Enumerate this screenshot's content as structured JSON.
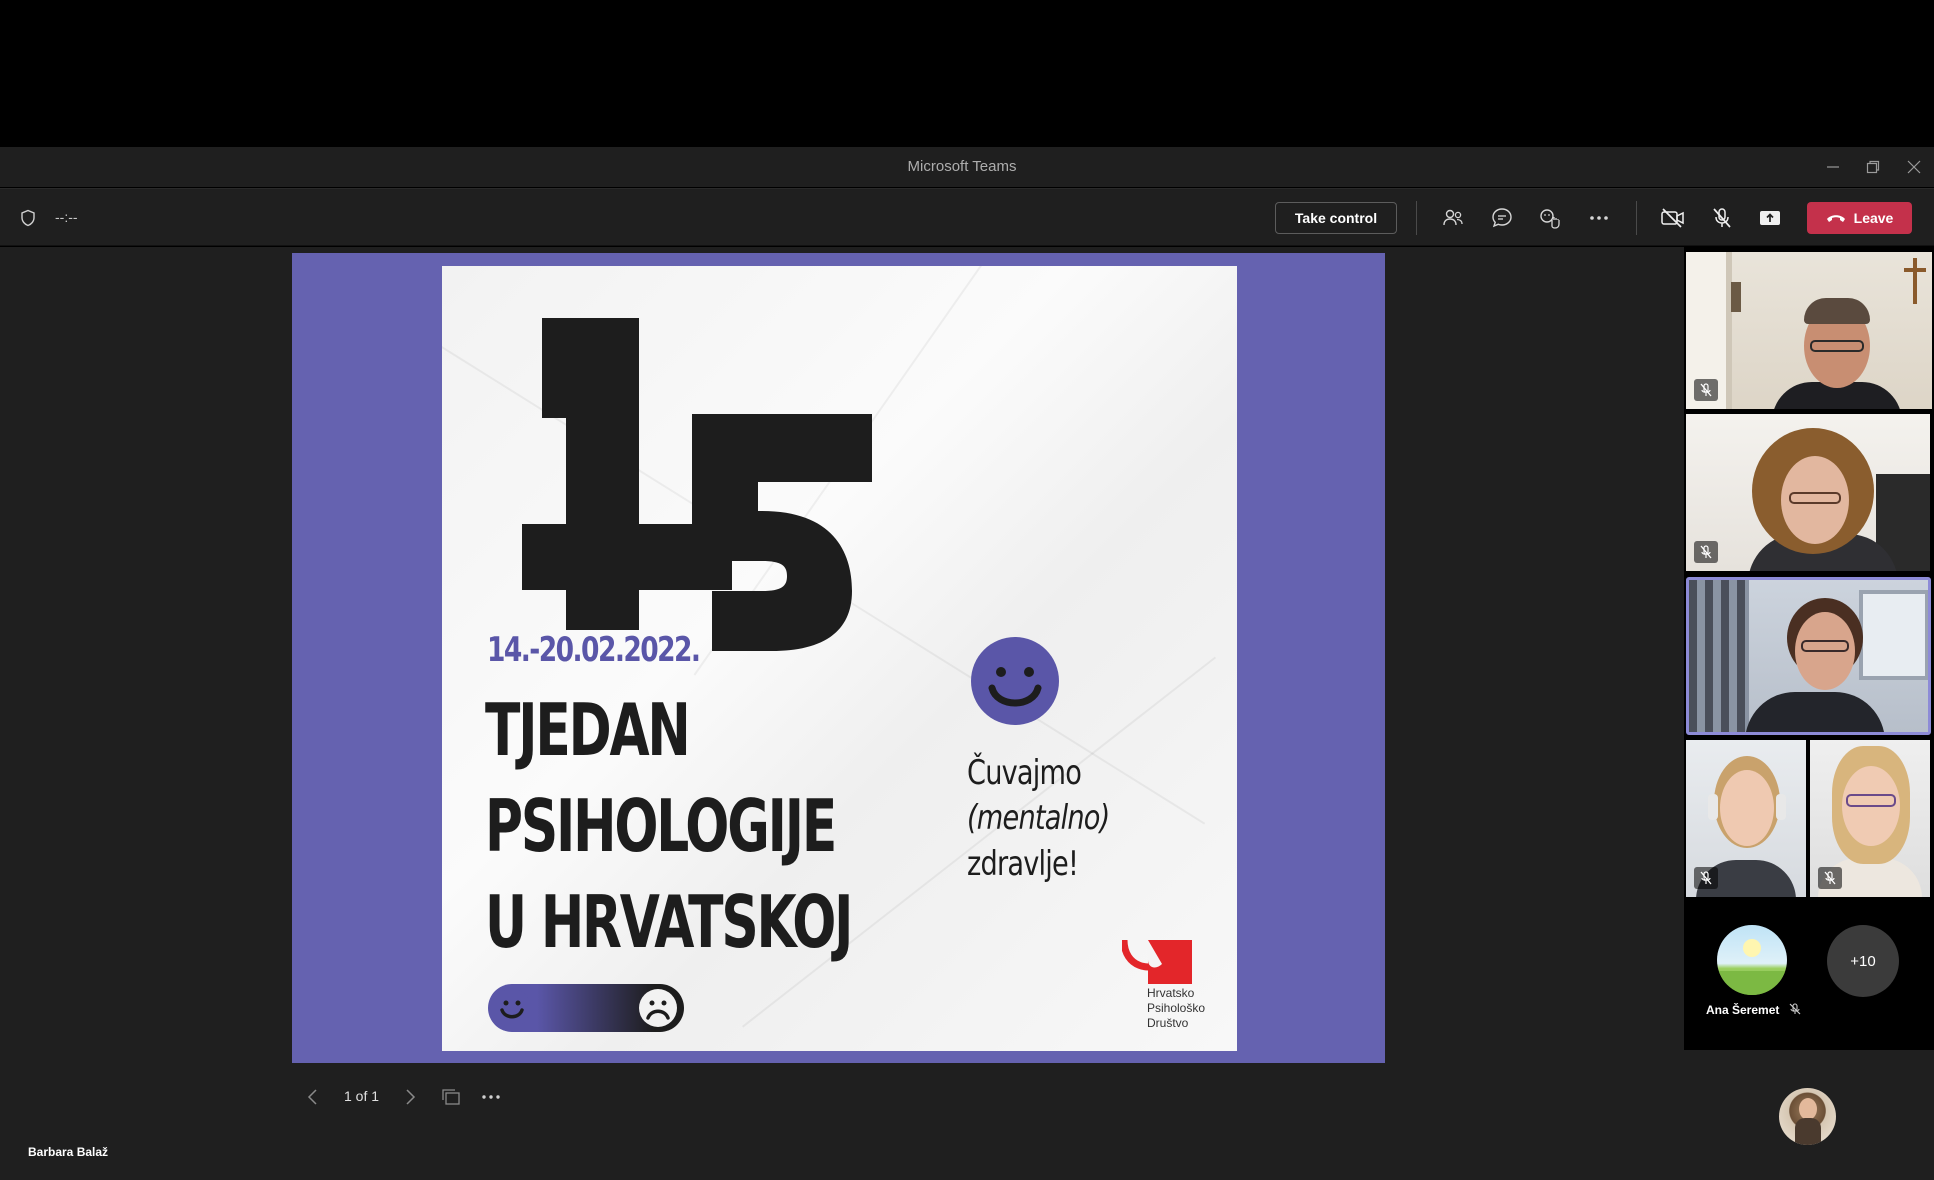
{
  "window": {
    "title": "Microsoft Teams"
  },
  "toolbar": {
    "timer": "--:--",
    "take_control_label": "Take control",
    "leave_label": "Leave"
  },
  "slide": {
    "big_number": "15",
    "dates": "14.-20.02.2022.",
    "headline": [
      "TJEDAN",
      "PSIHOLOGIJE",
      "U HRVATSKOJ"
    ],
    "slogan": [
      "Čuvajmo",
      "(mentalno)",
      "zdravlje!"
    ],
    "logo_text": [
      "Hrvatsko",
      "Psihološko",
      "Društvo"
    ],
    "colors": {
      "frame": "#6562b0",
      "accent": "#5a56a8",
      "ink": "#1d1d1d",
      "logo_red": "#e3262a"
    }
  },
  "pager": {
    "label": "1 of 1"
  },
  "stage": {
    "presenter_name": "Barbara Balaž"
  },
  "participants": {
    "named": "Ana Šeremet",
    "overflow": "+10"
  }
}
